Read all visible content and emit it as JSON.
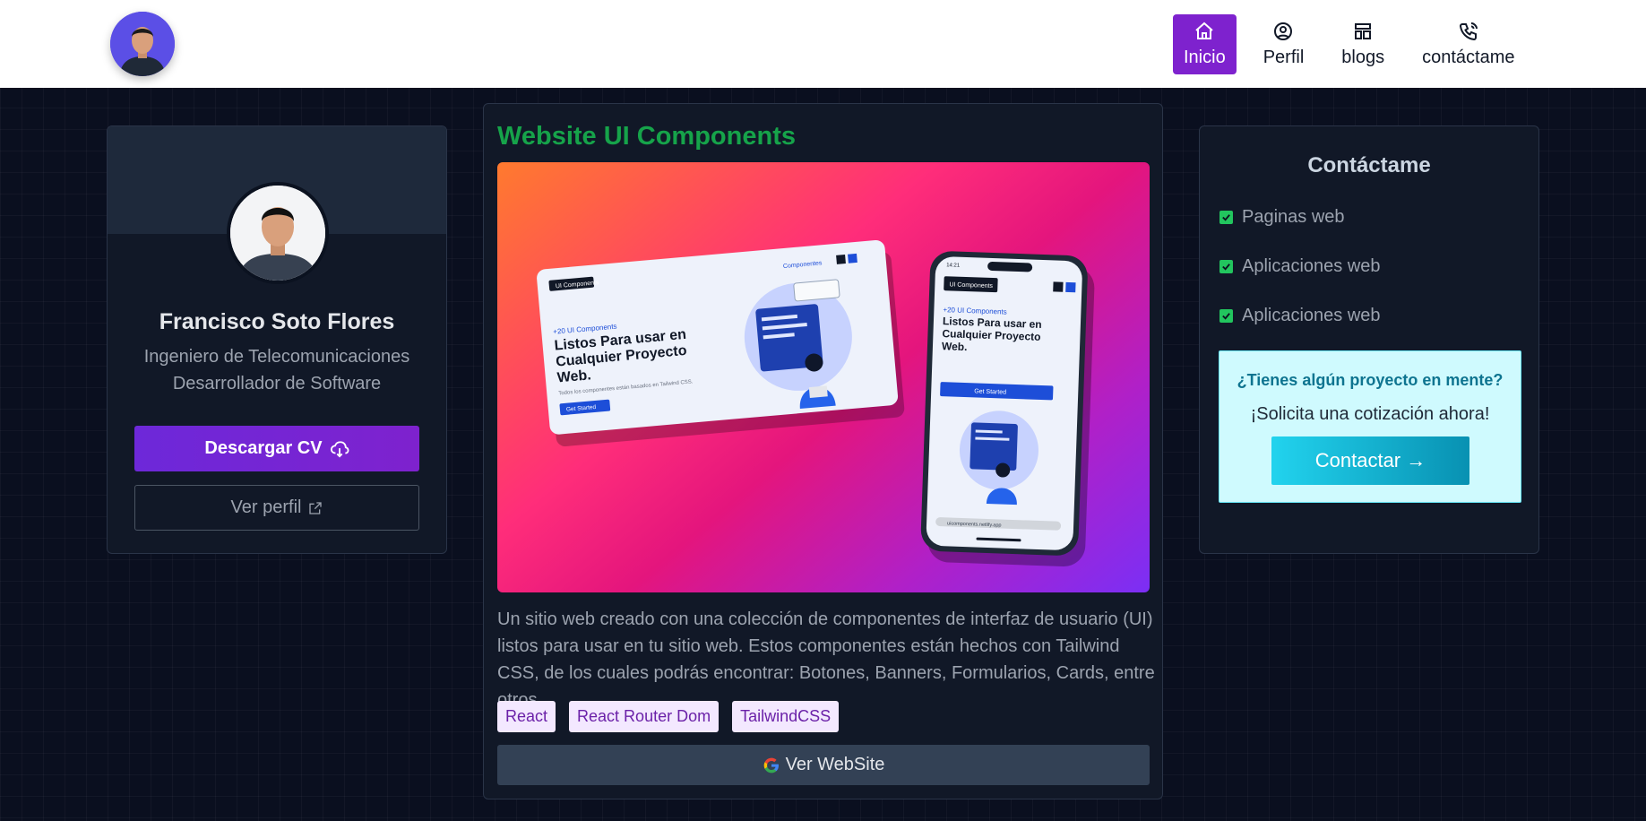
{
  "header": {
    "nav": [
      {
        "label": "Inicio",
        "icon": "home-icon",
        "active": true
      },
      {
        "label": "Perfil",
        "icon": "user-circle-icon",
        "active": false
      },
      {
        "label": "blogs",
        "icon": "layout-icon",
        "active": false
      },
      {
        "label": "contáctame",
        "icon": "phone-call-icon",
        "active": false
      }
    ]
  },
  "profile": {
    "name": "Francisco Soto Flores",
    "role_line1": "Ingeniero de Telecomunicaciones",
    "role_line2": "Desarrollador de Software",
    "download_cv_label": "Descargar CV",
    "view_profile_label": "Ver perfil"
  },
  "project": {
    "title": "Website UI Components",
    "description": "Un sitio web creado con una colección de componentes de interfaz de usuario (UI) listos para usar en tu sitio web. Estos componentes están hechos con Tailwind CSS, de los cuales podrás encontrar: Botones, Banners, Formularios, Cards, entre otros.",
    "tags": [
      "React",
      "React Router Dom",
      "TailwindCSS"
    ],
    "website_button_label": "Ver WebSite",
    "mockup": {
      "brand": "UI Components",
      "nav_link": "Componentes",
      "kicker": "+20 UI Components",
      "headline": "Listos Para usar en Cualquier Proyecto Web.",
      "subtext": "Todos los componentes están basados en Tailwind CSS.",
      "cta": "Get Started",
      "phone_time": "14:21",
      "phone_url": "uicomponents.netlify.app"
    }
  },
  "contact": {
    "title": "Contáctame",
    "items": [
      "Paginas web",
      "Aplicaciones web",
      "Aplicaciones web"
    ],
    "cta_question": "¿Tienes algún proyecto en mente?",
    "cta_sub": "¡Solicita una cotización ahora!",
    "cta_button": "Contactar →"
  },
  "colors": {
    "accent_purple": "#7e22ce",
    "title_green": "#16a34a",
    "cyan": "#22d3ee"
  }
}
